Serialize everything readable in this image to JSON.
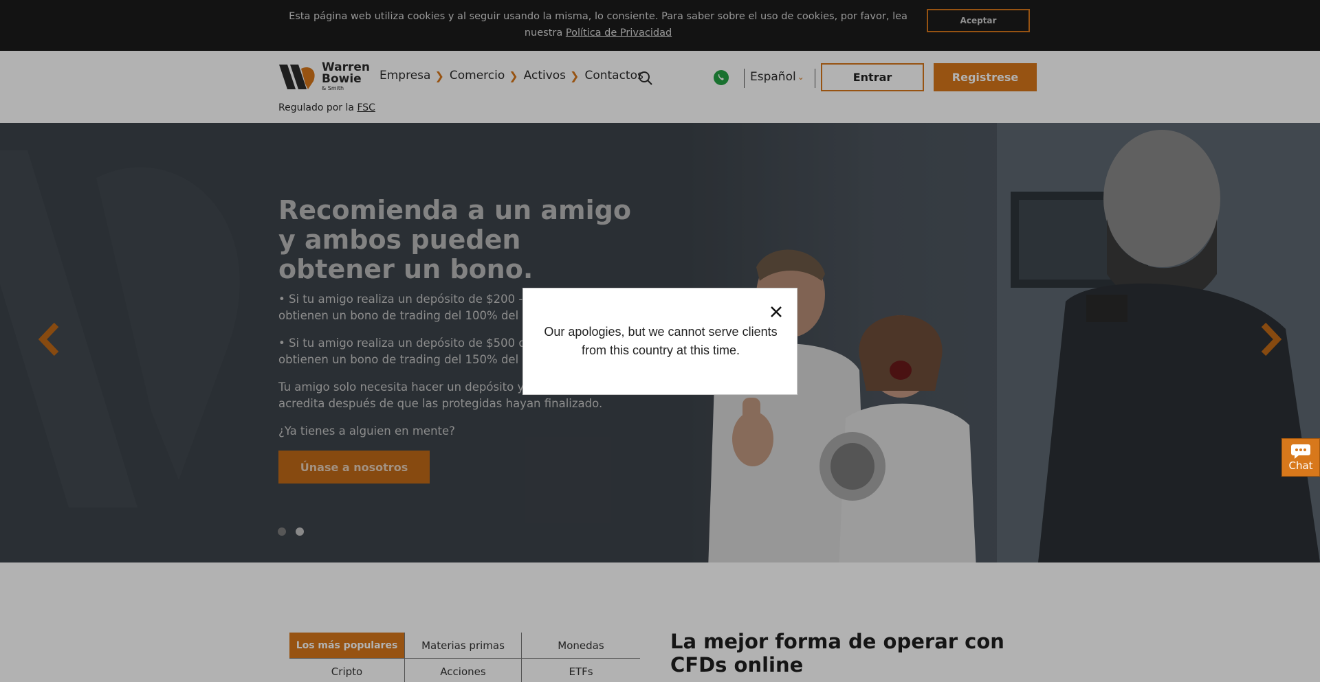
{
  "cookie": {
    "text": "Esta página web utiliza cookies y al seguir usando la misma, lo consiente. Para saber sobre el uso de cookies, por favor, lea nuestra",
    "link": "Política de Privacidad",
    "accept": "Aceptar"
  },
  "header": {
    "logo_line1": "Warren",
    "logo_line2": "Bowie",
    "logo_sub": "& Smith",
    "nav": [
      "Empresa",
      "Comercio",
      "Activos",
      "Contactos"
    ],
    "language": "Español",
    "login": "Entrar",
    "register": "Registrese",
    "regulated_prefix": "Regulado por la",
    "regulated_link": "FSC"
  },
  "hero": {
    "title": "Recomienda a un amigo y ambos pueden obtener un bono.",
    "p1": "• Si tu amigo realiza un depósito de $200 - $499, ambos obtienen un bono de trading del 100% del monto depositado.",
    "p2": "• Si tu amigo realiza un depósito de $500 o más, ambos obtienen un bono de trading del 150% del monto depositado.",
    "p3": "Tu amigo solo necesita hacer un depósito y el bono se acredita después de que las protegidas hayan finalizado.",
    "p4": "¿Ya tienes a alguien en mente?",
    "cta": "Únase a nosotros"
  },
  "modal": {
    "message": "Our apologies, but we cannot serve clients from this country at this time."
  },
  "chat": {
    "label": "Chat"
  },
  "tabs": [
    "Los más populares",
    "Materias primas",
    "Monedas",
    "Cripto",
    "Acciones",
    "ETFs"
  ],
  "section": {
    "title": "La mejor forma de operar con CFDs online"
  },
  "colors": {
    "accent": "#d8781b",
    "dark": "#1c1c1c"
  }
}
